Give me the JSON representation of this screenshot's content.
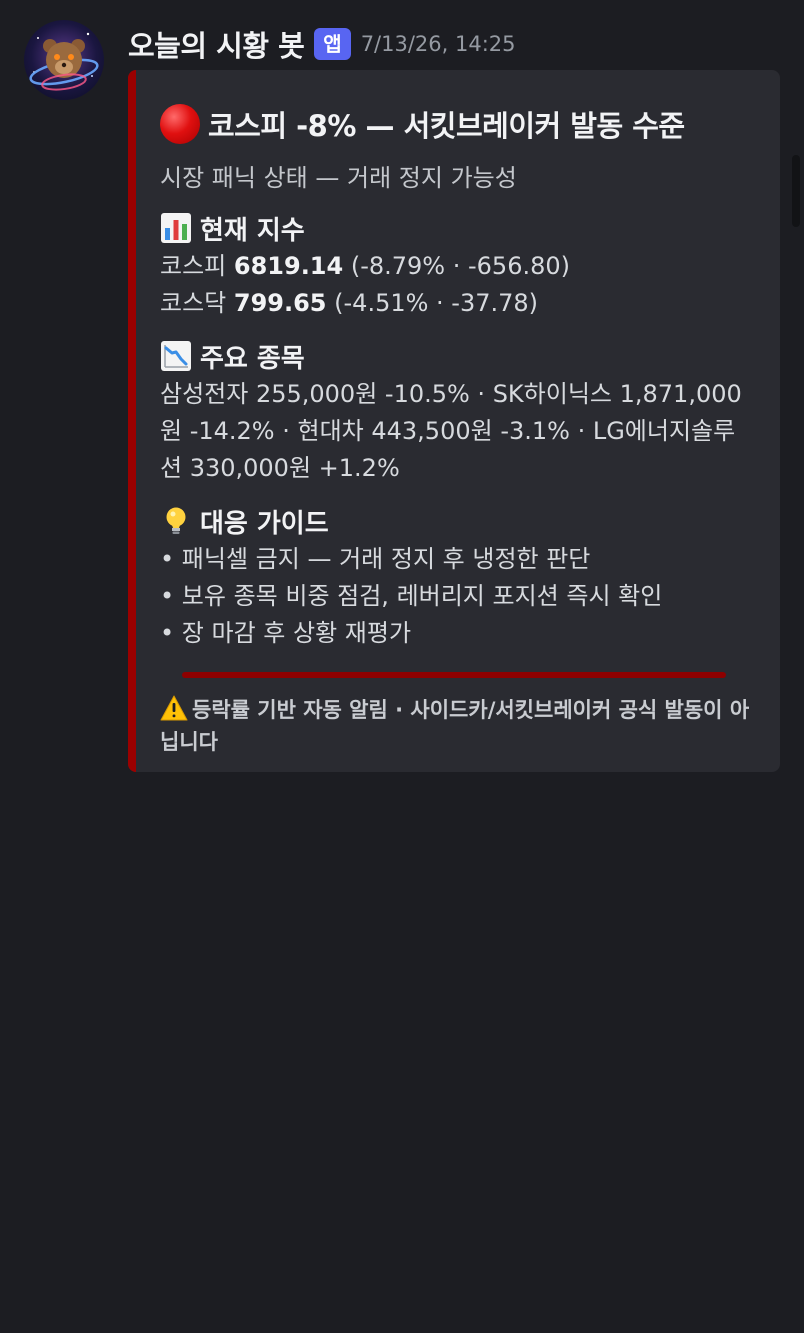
{
  "message": {
    "author": "오늘의 시황 봇",
    "badge": "앱",
    "timestamp": "7/13/26, 14:25"
  },
  "embed": {
    "title": "코스피 -8% — 서킷브레이커 발동 수준",
    "description": "시장 패닉 상태 — 거래 정지 가능성",
    "fields": {
      "index": {
        "title": "현재 지수",
        "kospi_name": "코스피",
        "kospi_value": "6819.14",
        "kospi_change": "(-8.79% · -656.80)",
        "kosdaq_name": "코스닥",
        "kosdaq_value": "799.65",
        "kosdaq_change": "(-4.51% · -37.78)"
      },
      "stocks": {
        "title": "주요 종목",
        "text": "삼성전자 255,000원 -10.5% · SK하이닉스 1,871,000원 -14.2% · 현대차 443,500원 -3.1% · LG에너지솔루션 330,000원 +1.2%"
      },
      "guide": {
        "title": "대응 가이드",
        "items": [
          "• 패닉셀 금지 — 거래 정지 후 냉정한 판단",
          "• 보유 종목 비중 점검, 레버리지 포지션 즉시 확인",
          "• 장 마감 후 상황 재평가"
        ]
      }
    },
    "footer": "등락률 기반 자동 알림 · 사이드카/서킷브레이커 공식 발동이 아닙니다",
    "colors": {
      "accent_bar": "#9b0000",
      "badge": "#5865f2",
      "background": "#1c1d22",
      "embed_background": "#2a2b31"
    },
    "icons": {
      "title": "red-circle-icon",
      "index": "bar-chart-icon",
      "stocks": "chart-decreasing-icon",
      "guide": "light-bulb-icon",
      "footer": "warning-icon"
    }
  }
}
